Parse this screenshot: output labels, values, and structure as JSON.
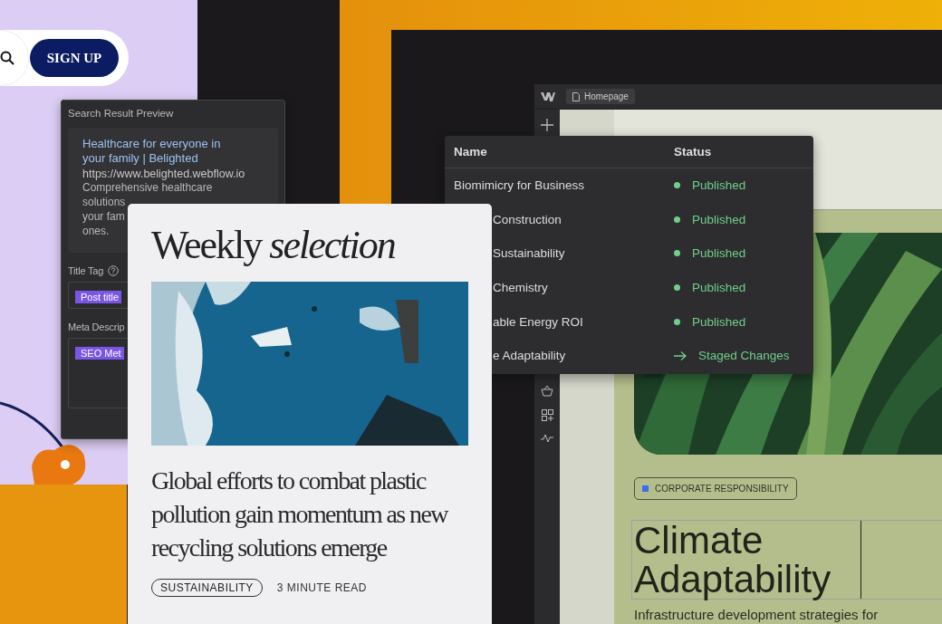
{
  "signup": {
    "button": "SIGN UP"
  },
  "search_preview": {
    "title": "Search Result Preview",
    "result_title": "Healthcare for everyone in your family | Belighted",
    "url": "https://www.belighted.webflow.io",
    "description_lines": [
      "Comprehensive healthcare",
      "solutions",
      "your fam",
      "ones."
    ],
    "fields": [
      {
        "label": "Title Tag",
        "help": true,
        "token": "Post title"
      },
      {
        "label": "Meta Descrip",
        "help": false,
        "token": "SEO Met"
      }
    ]
  },
  "article_card": {
    "heading": "Weekly *selection*",
    "headline": "Global efforts to combat plastic pollution gain momentum as new recycling solutions emerge",
    "tag": "SUSTAINABILITY",
    "read_time": "3 MINUTE READ"
  },
  "editor": {
    "tab": "Homepage",
    "tag": {
      "label": "CORPORATE RESPONSIBILITY",
      "color": "#3d6cf2"
    },
    "heading": "Climate Adaptability",
    "paragraph": "Infrastructure development strategies for"
  },
  "table": {
    "columns": [
      "Name",
      "Status"
    ],
    "rows": [
      {
        "name": "Biomimicry for Business",
        "partial": false,
        "status": "Published",
        "kind": "published"
      },
      {
        "name": "Construction",
        "partial": true,
        "status": "Published",
        "kind": "published"
      },
      {
        "name": "Sustainability",
        "partial": true,
        "status": "Published",
        "kind": "published"
      },
      {
        "name": "Chemistry",
        "partial": true,
        "status": "Published",
        "kind": "published"
      },
      {
        "name": "able Energy ROI",
        "partial": true,
        "status": "Published",
        "kind": "published"
      },
      {
        "name": "e Adaptability",
        "partial": true,
        "status": "Staged Changes",
        "kind": "staged"
      }
    ]
  }
}
